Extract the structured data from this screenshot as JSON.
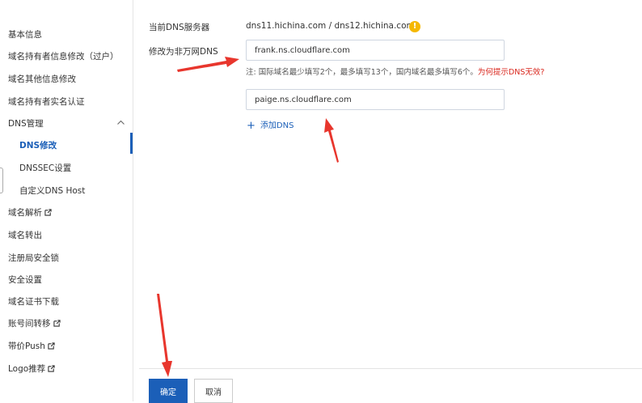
{
  "sidebar": {
    "items": [
      {
        "label": "基本信息"
      },
      {
        "label": "域名持有者信息修改（过户）"
      },
      {
        "label": "域名其他信息修改"
      },
      {
        "label": "域名持有者实名认证"
      },
      {
        "label": "DNS管理"
      },
      {
        "label": "DNS修改"
      },
      {
        "label": "DNSSEC设置"
      },
      {
        "label": "自定义DNS Host"
      },
      {
        "label": "域名解析"
      },
      {
        "label": "域名转出"
      },
      {
        "label": "注册局安全锁"
      },
      {
        "label": "安全设置"
      },
      {
        "label": "域名证书下载"
      },
      {
        "label": "账号间转移"
      },
      {
        "label": "带价Push"
      },
      {
        "label": "Logo推荐"
      }
    ]
  },
  "form": {
    "current_dns_label": "当前DNS服务器",
    "current_dns_value": "dns11.hichina.com / dns12.hichina.com",
    "modify_label": "修改为非万网DNS",
    "dns1_value": "frank.ns.cloudflare.com",
    "dns2_value": "paige.ns.cloudflare.com",
    "note_text": "注:  国际域名最少填写2个，最多填写13个，国内域名最多填写6个。",
    "note_link": "为何提示DNS无效?",
    "add_dns": "添加DNS",
    "warn_glyph": "!"
  },
  "buttons": {
    "confirm": "确定",
    "cancel": "取消"
  },
  "colors": {
    "primary": "#1b5fb8",
    "link_red": "#d9261c",
    "warning": "#f5b800",
    "annotation_arrow": "#e8362d"
  },
  "icons": {
    "external": "external-link-icon",
    "chevron": "chevron-up-icon",
    "warning": "warning-icon",
    "plus": "plus-icon"
  }
}
